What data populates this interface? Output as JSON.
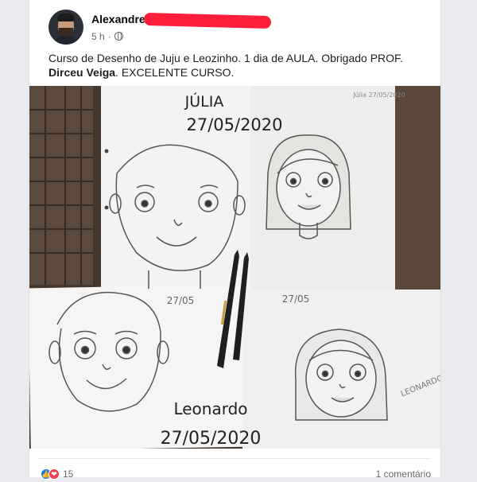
{
  "post": {
    "author": "Alexandre",
    "time": "5 h",
    "caption_text": "Curso de Desenho de Juju e Leozinho. 1 dia de AULA. Obrigado PROF. ",
    "caption_bold": "Dirceu Veiga",
    "caption_tail": ". EXCELENTE CURSO.",
    "privacy_icon": "globe-icon"
  },
  "photo": {
    "top_name": "JÚLIA",
    "top_date": "27/05/2020",
    "top_corner_note": "Júlia 27/05/2020",
    "bottom_left_date": "27/05",
    "bottom_right_date": "27/05",
    "bottom_name": "Leonardo",
    "bottom_date": "27/05/2020",
    "side_signature": "LEONARDO"
  },
  "footer": {
    "reaction_count": "15",
    "comments": "1 comentário",
    "reaction_icons": [
      "like-icon",
      "love-icon"
    ]
  },
  "colors": {
    "like": "#1877f2",
    "love": "#f33e58",
    "redaction": "#ff1f3a"
  }
}
